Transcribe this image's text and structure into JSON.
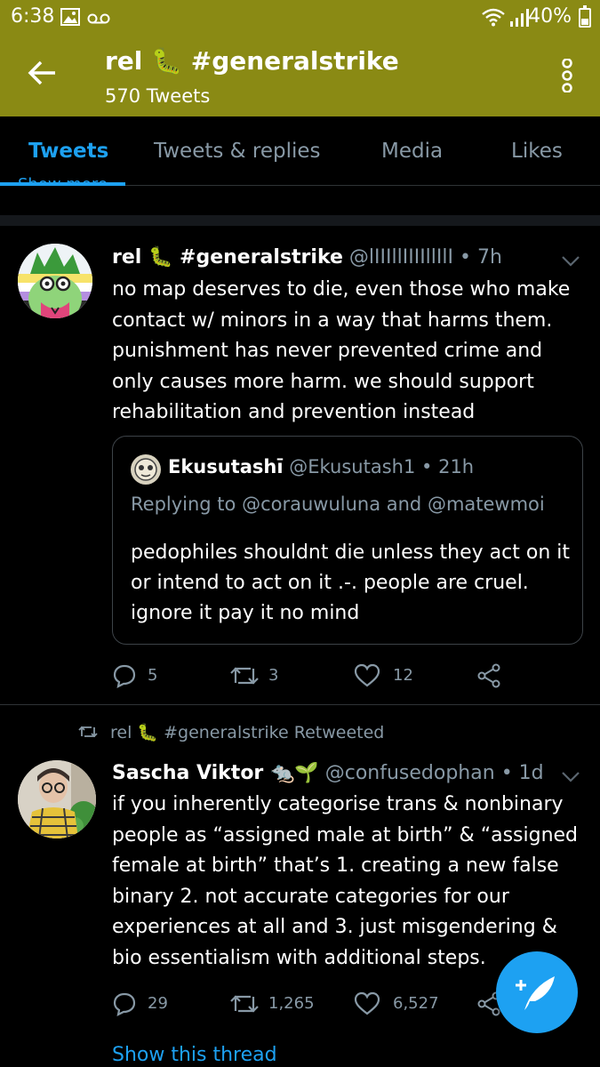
{
  "status_bar": {
    "time": "6:38",
    "battery": "40%"
  },
  "header": {
    "title": "rel 🐛 #generalstrike",
    "tweet_count": "570 Tweets"
  },
  "tabs": [
    {
      "label": "Tweets",
      "active": true
    },
    {
      "label": "Tweets & replies",
      "active": false
    },
    {
      "label": "Media",
      "active": false
    },
    {
      "label": "Likes",
      "active": false
    }
  ],
  "peek_text": "Show more",
  "tweets": [
    {
      "name": "rel 🐛 #generalstrike",
      "handle": "@lIIIllIIIIllIlI",
      "time": "• 7h",
      "text": "no map deserves to die, even those who make contact w/ minors in a way that harms them. punishment has never prevented crime and only causes more harm. we should support rehabilitation and prevention instead",
      "quote": {
        "name": "Ekusutashī",
        "handle": "@Ekusutash1",
        "time": "• 21h",
        "replying": "Replying to @corauwuluna and @matewmoi",
        "text": "pedophiles shouldnt die unless they act on it or intend to act on it .-. people are cruel. ignore it pay it no mind"
      },
      "replies": "5",
      "retweets": "3",
      "likes": "12"
    },
    {
      "retweeted_by": "rel 🐛 #generalstrike Retweeted",
      "name": "Sascha Viktor 🐀🌱",
      "handle": "@confusedophan",
      "time": "• 1d",
      "text": "if you inherently categorise trans & nonbinary people as “assigned male at birth” & “assigned female at birth” that’s 1. creating a new false binary 2. not accurate categories for our experiences at all and 3. just misgendering & bio essentialism with additional steps.",
      "replies": "29",
      "retweets": "1,265",
      "likes": "6,527",
      "show_thread": "Show this thread"
    }
  ],
  "colors": {
    "header_bg": "#8a8a14",
    "accent": "#1da1f2",
    "muted": "#8899a6",
    "background": "#000000"
  }
}
